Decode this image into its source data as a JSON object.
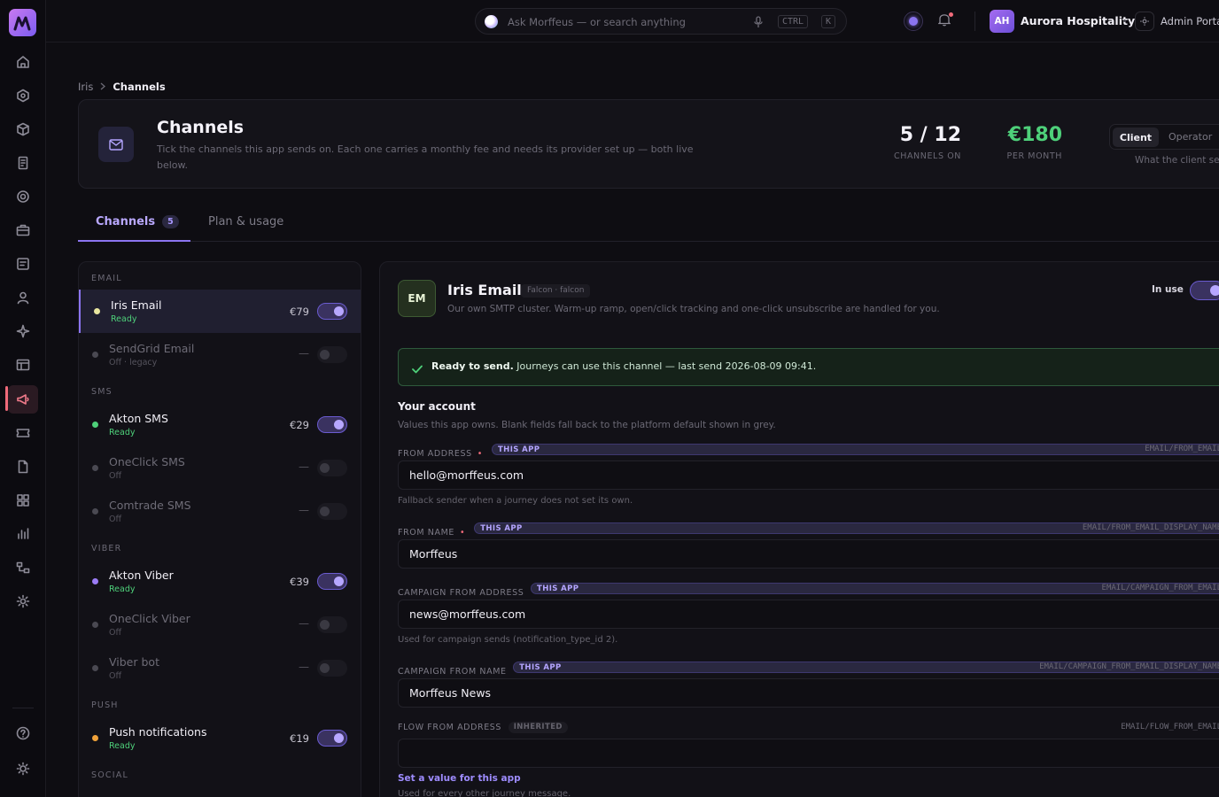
{
  "rail": {
    "items": [
      "home",
      "hexagon",
      "cube",
      "document",
      "target",
      "briefcase",
      "form",
      "user",
      "sparkle",
      "table",
      "megaphone",
      "tickets",
      "file",
      "grid",
      "chart",
      "flow",
      "settings"
    ],
    "active": "megaphone",
    "bottom": [
      "help",
      "theme"
    ]
  },
  "topbar": {
    "search_placeholder": "Ask Morffeus — or search anything",
    "kbd_ctrl": "CTRL",
    "kbd_k": "K",
    "avatar_initials": "AH",
    "org_name": "Aurora Hospitality",
    "portal_label": "Admin Portal"
  },
  "breadcrumb": {
    "parent": "Iris",
    "current": "Channels"
  },
  "hero": {
    "title": "Channels",
    "description": "Tick the channels this app sends on. Each one carries a monthly fee and needs its provider set up — both live below.",
    "channels_on_value": "5 / 12",
    "channels_on_label": "CHANNELS ON",
    "per_month_value": "€180",
    "per_month_label": "PER MONTH",
    "view_client": "Client",
    "view_operator": "Operator",
    "view_note": "What the client sees"
  },
  "tabs": {
    "channels_label": "Channels",
    "channels_count": "5",
    "plan_label": "Plan & usage"
  },
  "channel_list": {
    "groups": {
      "email": "EMAIL",
      "sms": "SMS",
      "viber": "VIBER",
      "push": "PUSH",
      "social": "SOCIAL"
    },
    "items": [
      {
        "name": "Iris Email",
        "status": "Ready",
        "price": "€79",
        "on": true,
        "dot": "#e9e6a0"
      },
      {
        "name": "SendGrid Email",
        "status": "Off · legacy",
        "price": "—",
        "on": false,
        "dot": "#4a4952"
      },
      {
        "name": "Akton SMS",
        "status": "Ready",
        "price": "€29",
        "on": true,
        "dot": "#4ed07a"
      },
      {
        "name": "OneClick SMS",
        "status": "Off",
        "price": "—",
        "on": false,
        "dot": "#4a4952"
      },
      {
        "name": "Comtrade SMS",
        "status": "Off",
        "price": "—",
        "on": false,
        "dot": "#4a4952"
      },
      {
        "name": "Akton Viber",
        "status": "Ready",
        "price": "€39",
        "on": true,
        "dot": "#9b7cf5"
      },
      {
        "name": "OneClick Viber",
        "status": "Off",
        "price": "—",
        "on": false,
        "dot": "#4a4952"
      },
      {
        "name": "Viber bot",
        "status": "Off",
        "price": "—",
        "on": false,
        "dot": "#4a4952"
      },
      {
        "name": "Push notifications",
        "status": "Ready",
        "price": "€19",
        "on": true,
        "dot": "#f0a23a"
      }
    ]
  },
  "detail": {
    "badge": "EM",
    "title": "Iris Email",
    "chip": "Falcon · falcon",
    "description": "Our own SMTP cluster. Warm-up ramp, open/click tracking and one-click unsubscribe are handled for you.",
    "in_use_label": "In use",
    "ready_bold": "Ready to send.",
    "ready_text": "Journeys can use this channel — last send 2026-08-09 09:41.",
    "account_title": "Your account",
    "account_sub": "Values this app owns. Blank fields fall back to the platform default shown in grey.",
    "tag_app": "THIS APP",
    "tag_inherited": "INHERITED",
    "fields": {
      "from_address": {
        "label": "FROM ADDRESS",
        "key": "EMAIL/FROM_EMAIL",
        "value": "hello@morffeus.com",
        "help": "Fallback sender when a journey does not set its own."
      },
      "from_name": {
        "label": "FROM NAME",
        "key": "EMAIL/FROM_EMAIL_DISPLAY_NAME",
        "value": "Morffeus"
      },
      "campaign_from_address": {
        "label": "CAMPAIGN FROM ADDRESS",
        "key": "EMAIL/CAMPAIGN_FROM_EMAIL",
        "value": "news@morffeus.com",
        "help": "Used for campaign sends (notification_type_id 2)."
      },
      "campaign_from_name": {
        "label": "CAMPAIGN FROM NAME",
        "key": "EMAIL/CAMPAIGN_FROM_EMAIL_DISPLAY_NAME",
        "value": "Morffeus News"
      },
      "flow_from_address": {
        "label": "FLOW FROM ADDRESS",
        "key": "EMAIL/FLOW_FROM_EMAIL",
        "value": "",
        "link": "Set a value for this app",
        "help": "Used for every other journey message."
      }
    }
  },
  "colors": {
    "accent": "#8b74f0",
    "ready": "#4ed07a",
    "danger": "#f06a7a"
  }
}
